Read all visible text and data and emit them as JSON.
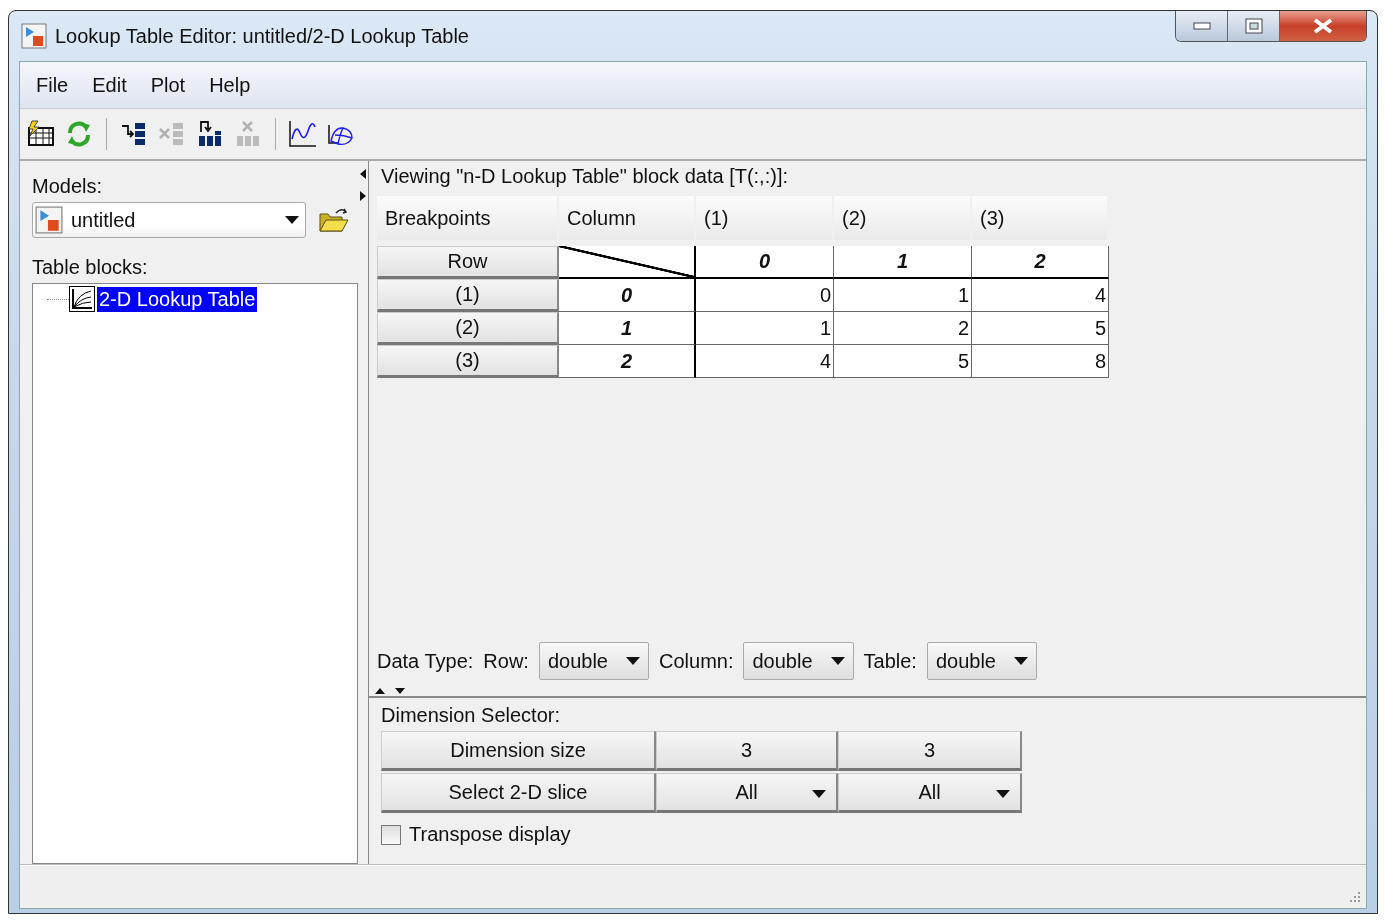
{
  "window": {
    "title": "Lookup Table Editor: untitled/2-D Lookup Table"
  },
  "menu": [
    "File",
    "Edit",
    "Plot",
    "Help"
  ],
  "toolbar": [
    {
      "kind": "table",
      "disabled": false
    },
    {
      "kind": "refresh",
      "disabled": false
    },
    {
      "kind": "separator"
    },
    {
      "kind": "insert-row",
      "disabled": false
    },
    {
      "kind": "delete-row",
      "disabled": true
    },
    {
      "kind": "insert-column",
      "disabled": false
    },
    {
      "kind": "delete-column",
      "disabled": true
    },
    {
      "kind": "separator"
    },
    {
      "kind": "line-plot",
      "disabled": false
    },
    {
      "kind": "mesh-plot",
      "disabled": false
    }
  ],
  "models": {
    "label": "Models:",
    "value": "untitled"
  },
  "table_blocks": {
    "label": "Table blocks:",
    "items": [
      {
        "label": "2-D Lookup Table",
        "selected": true
      }
    ]
  },
  "viewer": {
    "title": "Viewing \"n-D Lookup Table\" block data [T(:,:)]:",
    "header": [
      "Breakpoints",
      "Column",
      "(1)",
      "(2)",
      "(3)"
    ],
    "row_label": "Row",
    "column_breakpoints": [
      "0",
      "1",
      "2"
    ],
    "rows": [
      {
        "index": "(1)",
        "breakpoint": "0",
        "values": [
          "0",
          "1",
          "4"
        ]
      },
      {
        "index": "(2)",
        "breakpoint": "1",
        "values": [
          "1",
          "2",
          "5"
        ]
      },
      {
        "index": "(3)",
        "breakpoint": "2",
        "values": [
          "4",
          "5",
          "8"
        ]
      }
    ]
  },
  "data_type": {
    "label": "Data Type:",
    "fields": [
      {
        "label": "Row:",
        "value": "double"
      },
      {
        "label": "Column:",
        "value": "double"
      },
      {
        "label": "Table:",
        "value": "double"
      }
    ]
  },
  "dimension_selector": {
    "title": "Dimension Selector:",
    "size_label": "Dimension size",
    "sizes": [
      "3",
      "3"
    ],
    "slice_label": "Select 2-D slice",
    "slices": [
      "All",
      "All"
    ]
  },
  "transpose": {
    "label": "Transpose display",
    "checked": false
  }
}
